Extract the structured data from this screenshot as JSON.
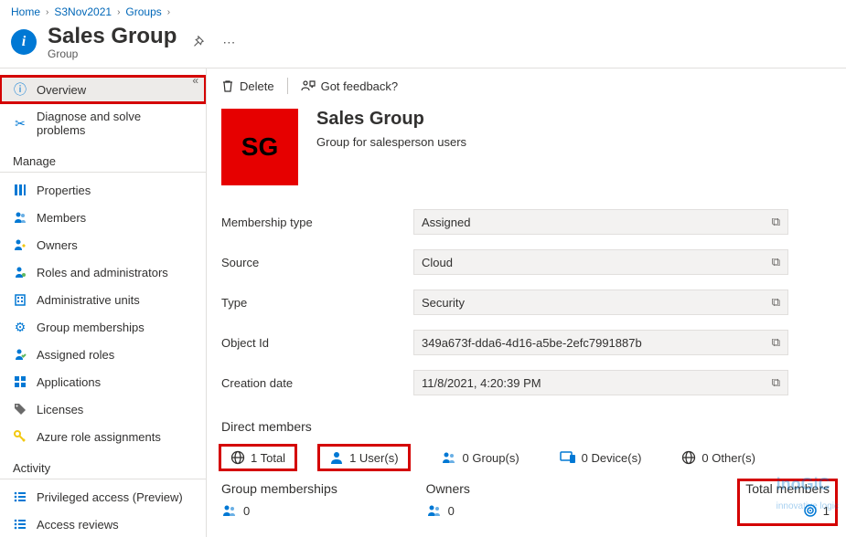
{
  "breadcrumb": [
    {
      "label": "Home"
    },
    {
      "label": "S3Nov2021"
    },
    {
      "label": "Groups"
    }
  ],
  "page": {
    "title": "Sales Group",
    "subtitle": "Group"
  },
  "toolbar": {
    "delete": "Delete",
    "feedback": "Got feedback?"
  },
  "card": {
    "tile": "SG",
    "title": "Sales Group",
    "description": "Group for salesperson users"
  },
  "props": {
    "membership_type": {
      "label": "Membership type",
      "value": "Assigned"
    },
    "source": {
      "label": "Source",
      "value": "Cloud"
    },
    "type": {
      "label": "Type",
      "value": "Security"
    },
    "object_id": {
      "label": "Object Id",
      "value": "349a673f-dda6-4d16-a5be-2efc7991887b"
    },
    "creation_date": {
      "label": "Creation date",
      "value": "11/8/2021, 4:20:39 PM"
    }
  },
  "direct_members": {
    "heading": "Direct members",
    "total": "1 Total",
    "users": "1 User(s)",
    "groups": "0 Group(s)",
    "devices": "0 Device(s)",
    "others": "0 Other(s)"
  },
  "group_memberships": {
    "heading": "Group memberships",
    "count": "0"
  },
  "owners": {
    "heading": "Owners",
    "count": "0"
  },
  "total_members": {
    "heading": "Total members",
    "count": "1"
  },
  "sidebar": {
    "overview": "Overview",
    "diagnose": "Diagnose and solve problems",
    "section_manage": "Manage",
    "properties": "Properties",
    "members": "Members",
    "owners": "Owners",
    "roles": "Roles and administrators",
    "admin_units": "Administrative units",
    "group_memberships": "Group memberships",
    "assigned_roles": "Assigned roles",
    "applications": "Applications",
    "licenses": "Licenses",
    "azure_roles": "Azure role assignments",
    "section_activity": "Activity",
    "privileged": "Privileged access (Preview)",
    "access_reviews": "Access reviews"
  }
}
